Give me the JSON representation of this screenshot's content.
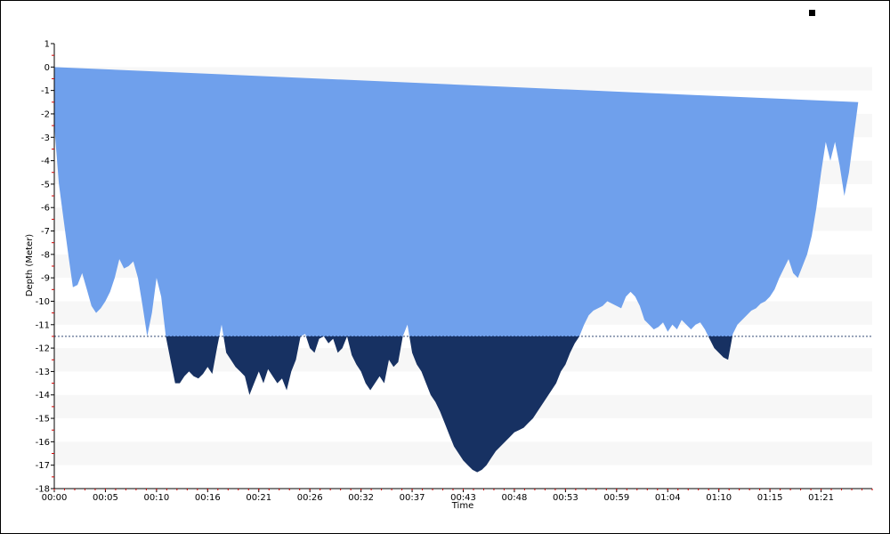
{
  "chart_data": {
    "type": "area",
    "title": "",
    "xlabel": "Time",
    "ylabel": "Depth (Meter)",
    "x_unit": "minutes",
    "xlim": [
      0,
      88
    ],
    "ylim": [
      -18,
      1
    ],
    "grid_bands": true,
    "yticks": [
      1,
      0,
      -1,
      -2,
      -3,
      -4,
      -5,
      -6,
      -7,
      -8,
      -9,
      -10,
      -11,
      -12,
      -13,
      -14,
      -15,
      -16,
      -17,
      -18
    ],
    "xticks": [
      {
        "t": 0,
        "label": "00:00"
      },
      {
        "t": 5.5,
        "label": "00:05"
      },
      {
        "t": 11,
        "label": "00:10"
      },
      {
        "t": 16.5,
        "label": "00:16"
      },
      {
        "t": 22,
        "label": "00:21"
      },
      {
        "t": 27.5,
        "label": "00:26"
      },
      {
        "t": 33,
        "label": "00:32"
      },
      {
        "t": 38.5,
        "label": "00:37"
      },
      {
        "t": 44,
        "label": "00:43"
      },
      {
        "t": 49.5,
        "label": "00:48"
      },
      {
        "t": 55,
        "label": "00:53"
      },
      {
        "t": 60.5,
        "label": "00:59"
      },
      {
        "t": 66,
        "label": "01:04"
      },
      {
        "t": 71.5,
        "label": "01:10"
      },
      {
        "t": 77,
        "label": "01:15"
      },
      {
        "t": 82.5,
        "label": "01:21"
      }
    ],
    "reference_depth": -11.5,
    "colors": {
      "shallow": "#6fa0ec",
      "deep": "#173162",
      "band": "#f7f7f7",
      "reference": "#173162"
    },
    "series": [
      {
        "x": [
          0,
          0.5,
          1,
          1.5,
          2,
          2.5,
          3,
          3.5,
          4,
          4.5,
          5,
          5.5,
          6,
          6.5,
          7,
          7.5,
          8,
          8.5,
          9,
          9.5,
          10,
          10.5,
          11,
          11.5,
          12,
          12.5,
          13,
          13.5,
          14,
          14.5,
          15,
          15.5,
          16,
          16.5,
          17,
          17.5,
          18,
          18.5,
          19,
          19.5,
          20,
          20.5,
          21,
          21.5,
          22,
          22.5,
          23,
          23.5,
          24,
          24.5,
          25,
          25.5,
          26,
          26.5,
          27,
          27.5,
          28,
          28.5,
          29,
          29.5,
          30,
          30.5,
          31,
          31.5,
          32,
          32.5,
          33,
          33.5,
          34,
          34.5,
          35,
          35.5,
          36,
          36.5,
          37,
          37.5,
          38,
          38.5,
          39,
          39.5,
          40,
          40.5,
          41,
          41.5,
          42,
          42.5,
          43,
          43.5,
          44,
          44.5,
          45,
          45.5,
          46,
          46.5,
          47,
          47.5,
          48,
          48.5,
          49,
          49.5,
          50,
          50.5,
          51,
          51.5,
          52,
          52.5,
          53,
          53.5,
          54,
          54.5,
          55,
          55.5,
          56,
          56.5,
          57,
          57.5,
          58,
          58.5,
          59,
          59.5,
          60,
          60.5,
          61,
          61.5,
          62,
          62.5,
          63,
          63.5,
          64,
          64.5,
          65,
          65.5,
          66,
          66.5,
          67,
          67.5,
          68,
          68.5,
          69,
          69.5,
          70,
          70.5,
          71,
          71.5,
          72,
          72.5,
          73,
          73.5,
          74,
          74.5,
          75,
          75.5,
          76,
          76.5,
          77,
          77.5,
          78,
          78.5,
          79,
          79.5,
          80,
          80.5,
          81,
          81.5,
          82,
          82.5,
          83,
          83.5,
          84,
          84.5,
          85,
          85.5,
          86,
          86.5,
          87,
          87.5,
          88
        ],
        "depth": [
          -2.5,
          -5.0,
          -6.5,
          -8.0,
          -9.4,
          -9.3,
          -8.8,
          -9.5,
          -10.2,
          -10.5,
          -10.3,
          -10.0,
          -9.6,
          -9.0,
          -8.2,
          -8.6,
          -8.5,
          -8.3,
          -9.0,
          -10.2,
          -11.5,
          -10.5,
          -9.0,
          -9.8,
          -11.5,
          -12.5,
          -13.5,
          -13.5,
          -13.2,
          -13.0,
          -13.2,
          -13.3,
          -13.1,
          -12.8,
          -13.1,
          -12.0,
          -11.0,
          -12.2,
          -12.5,
          -12.8,
          -13.0,
          -13.2,
          -14.0,
          -13.5,
          -13.0,
          -13.5,
          -12.9,
          -13.2,
          -13.5,
          -13.3,
          -13.8,
          -13.0,
          -12.5,
          -11.5,
          -11.4,
          -12.0,
          -12.2,
          -11.6,
          -11.5,
          -11.8,
          -11.6,
          -12.2,
          -12.0,
          -11.5,
          -12.3,
          -12.7,
          -13.0,
          -13.5,
          -13.8,
          -13.5,
          -13.2,
          -13.5,
          -12.5,
          -12.8,
          -12.6,
          -11.5,
          -11.0,
          -12.2,
          -12.7,
          -13.0,
          -13.5,
          -14.0,
          -14.3,
          -14.7,
          -15.2,
          -15.7,
          -16.2,
          -16.5,
          -16.8,
          -17.0,
          -17.2,
          -17.3,
          -17.2,
          -17.0,
          -16.7,
          -16.4,
          -16.2,
          -16.0,
          -15.8,
          -15.6,
          -15.5,
          -15.4,
          -15.2,
          -15.0,
          -14.7,
          -14.4,
          -14.1,
          -13.8,
          -13.5,
          -13.0,
          -12.7,
          -12.2,
          -11.8,
          -11.5,
          -11.0,
          -10.6,
          -10.4,
          -10.3,
          -10.2,
          -10.0,
          -10.1,
          -10.2,
          -10.3,
          -9.8,
          -9.6,
          -9.8,
          -10.2,
          -10.8,
          -11.0,
          -11.2,
          -11.1,
          -10.9,
          -11.3,
          -11.0,
          -11.2,
          -10.8,
          -11.0,
          -11.2,
          -11.0,
          -10.9,
          -11.2,
          -11.6,
          -12.0,
          -12.2,
          -12.4,
          -12.5,
          -11.4,
          -11.0,
          -10.8,
          -10.6,
          -10.4,
          -10.3,
          -10.1,
          -10.0,
          -9.8,
          -9.5,
          -9.0,
          -8.6,
          -8.2,
          -8.8,
          -9.0,
          -8.5,
          -8.0,
          -7.2,
          -6.0,
          -4.5,
          -3.2,
          -4.0,
          -3.2,
          -4.2,
          -5.5,
          -4.5,
          -3.0,
          -1.5
        ]
      }
    ]
  }
}
